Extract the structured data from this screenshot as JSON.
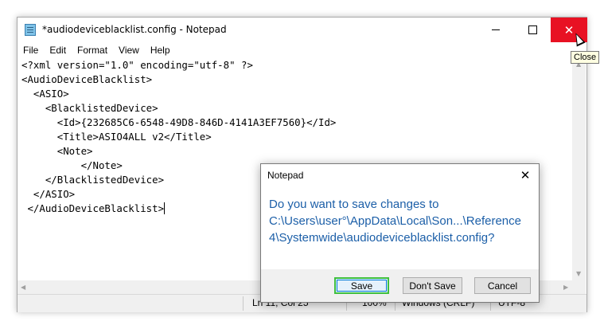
{
  "window": {
    "title": "*audiodeviceblacklist.config - Notepad",
    "close_glyph": "✕",
    "close_tooltip": "Close"
  },
  "menu": [
    "File",
    "Edit",
    "Format",
    "View",
    "Help"
  ],
  "editor": {
    "lines": [
      "<?xml version=\"1.0\" encoding=\"utf-8\" ?>",
      "<AudioDeviceBlacklist>",
      "  <ASIO>",
      "    <BlacklistedDevice>",
      "      <Id>{232685C6-6548-49D8-846D-4141A3EF7560}</Id>",
      "      <Title>ASIO4ALL v2</Title>",
      "      <Note>",
      "          </Note>",
      "    </BlacklistedDevice>",
      "  </ASIO>",
      " </AudioDeviceBlacklist>"
    ]
  },
  "status": {
    "position": "Ln 11, Col 25",
    "zoom": "100%",
    "line_ending": "Windows (CRLF)",
    "encoding": "UTF-8"
  },
  "dialog": {
    "title": "Notepad",
    "close_glyph": "✕",
    "message_line1": "Do you want to save changes to",
    "message_line2": "C:\\Users\\user°\\AppData\\Local\\Son...\\Reference",
    "message_line3": "4\\Systemwide\\audiodeviceblacklist.config?",
    "save_label": "Save",
    "dont_save_label": "Don't Save",
    "cancel_label": "Cancel"
  },
  "colors": {
    "close_button": "#e81123",
    "dialog_message": "#1c5fa8",
    "save_highlight": "#3fbf3f"
  }
}
